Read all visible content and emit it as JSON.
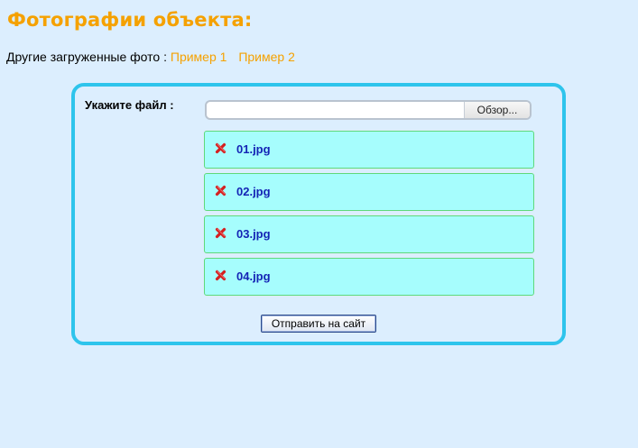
{
  "page": {
    "title": "Фотографии объекта:"
  },
  "other_photos": {
    "label": "Другие загруженные фото :",
    "links": [
      {
        "label": "Пример 1"
      },
      {
        "label": "Пример 2"
      }
    ]
  },
  "upload": {
    "file_label": "Укажите файл :",
    "browse_label": "Обзор...",
    "file_value": "",
    "files": [
      {
        "name": "01.jpg",
        "delete_icon": "red-x-icon"
      },
      {
        "name": "02.jpg",
        "delete_icon": "red-x-icon"
      },
      {
        "name": "03.jpg",
        "delete_icon": "red-x-icon"
      },
      {
        "name": "04.jpg",
        "delete_icon": "red-x-icon"
      }
    ],
    "submit_label": "Отправить на сайт"
  },
  "colors": {
    "background": "#dceefe",
    "accent": "#f5a100",
    "panel_border": "#2ec4ec",
    "file_item_bg": "#a6fdfd",
    "file_item_border": "#5fd97a",
    "file_name": "#1424b5",
    "delete_icon": "#d42020"
  }
}
